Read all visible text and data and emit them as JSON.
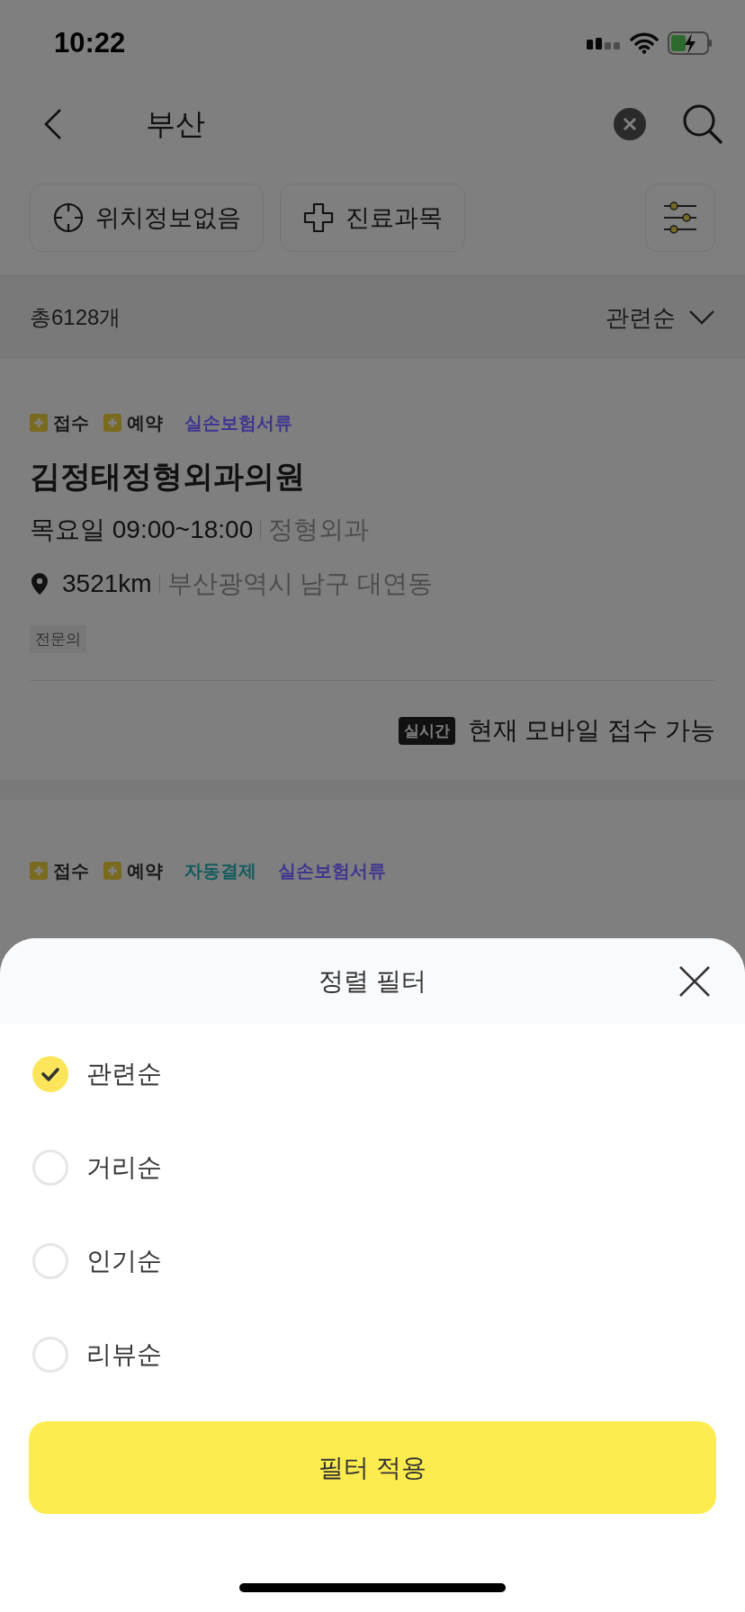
{
  "status_bar": {
    "time": "10:22"
  },
  "search": {
    "query": "부산"
  },
  "chips": [
    {
      "label": "위치정보없음",
      "kind": "location"
    },
    {
      "label": "진료과목",
      "kind": "department"
    }
  ],
  "result": {
    "count": "총6128개",
    "sort": "관련순"
  },
  "clinics": [
    {
      "tags": [
        {
          "label": "접수",
          "kind": "service"
        },
        {
          "label": "예약",
          "kind": "service"
        },
        {
          "label": "실손보험서류",
          "kind": "label",
          "color": "#3f3690"
        }
      ],
      "name": "김정태정형외과의원",
      "hours": "목요일 09:00~18:00",
      "department": "정형외과",
      "distance": "3521km",
      "address": "부산광역시 남구 대연동",
      "badges": [
        "전문의"
      ],
      "realtime": {
        "label": "실시간",
        "text": "현재 모바일 접수 가능"
      }
    },
    {
      "tags": [
        {
          "label": "접수",
          "kind": "service"
        },
        {
          "label": "예약",
          "kind": "service"
        },
        {
          "label": "자동결제",
          "kind": "label",
          "color": "#145c5e"
        },
        {
          "label": "실손보험서류",
          "kind": "label",
          "color": "#3f3690"
        }
      ]
    }
  ],
  "sheet": {
    "title": "정렬 필터",
    "options": [
      {
        "label": "관련순",
        "selected": true
      },
      {
        "label": "거리순",
        "selected": false
      },
      {
        "label": "인기순",
        "selected": false
      },
      {
        "label": "리뷰순",
        "selected": false
      }
    ],
    "apply": "필터 적용"
  }
}
